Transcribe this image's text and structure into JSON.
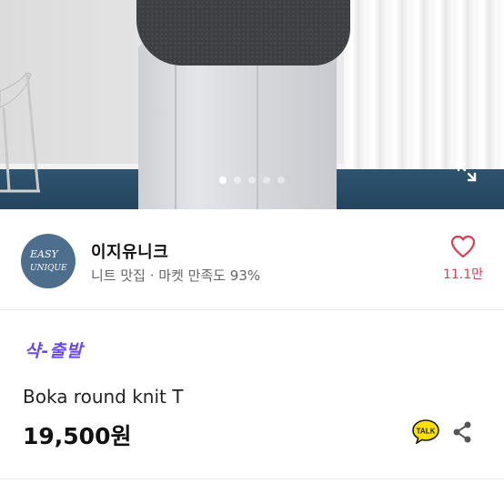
{
  "image_viewer": {
    "slide_count": 5,
    "active_slide": 1
  },
  "shop": {
    "logo_text_line1": "EASY",
    "logo_text_line2": "UNIQUE",
    "name": "이지유니크",
    "meta": "니트 맛집 · 마켓 만족도 93%",
    "like_count": "11.1만"
  },
  "product": {
    "delivery_badge": "샥-출발",
    "title": "Boka round knit T",
    "price": "19,500원"
  },
  "talk_button": {
    "label": "TALK"
  },
  "colors": {
    "accent_purple": "#6a49f0",
    "heart_red": "#e13b52",
    "logo_blue": "#4d6f8d",
    "talk_yellow": "#fae100"
  }
}
